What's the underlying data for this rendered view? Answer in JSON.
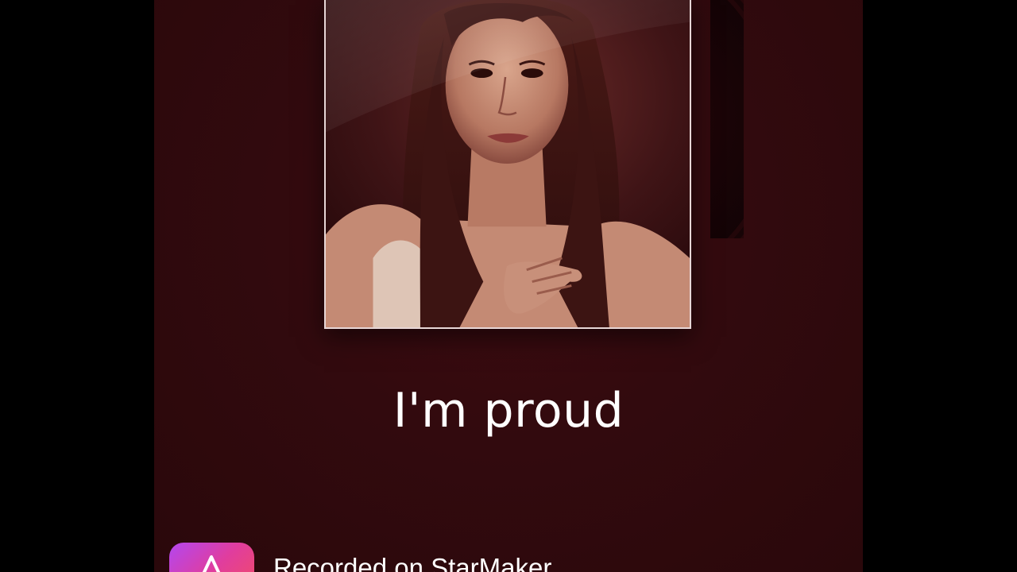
{
  "song": {
    "title": "I'm proud"
  },
  "footer": {
    "recorded_label": "Recorded on StarMaker",
    "logo_icon": "starmaker-logo-icon"
  },
  "colors": {
    "panel_background": "#320a0e",
    "outer_background": "#000000",
    "logo_gradient_start": "#b347f0",
    "logo_gradient_end": "#f04a6d",
    "text": "#ffffff"
  }
}
